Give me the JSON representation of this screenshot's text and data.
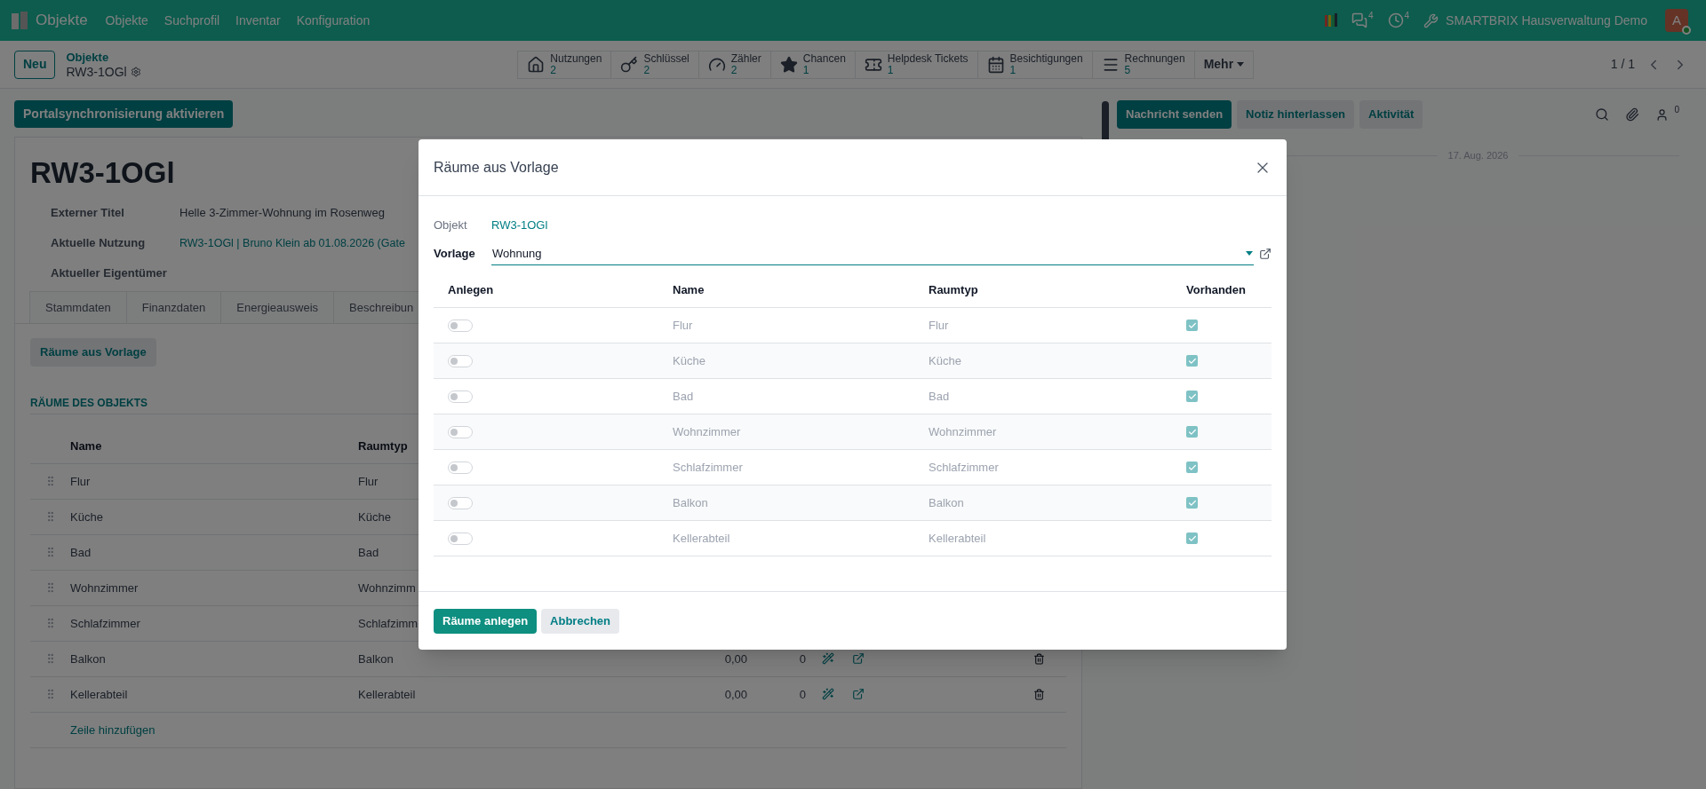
{
  "navbar": {
    "app": "Objekte",
    "menu": [
      "Objekte",
      "Suchprofil",
      "Inventar",
      "Konfiguration"
    ],
    "chat_count": "4",
    "activity_count": "4",
    "company": "SMARTBRIX Hausverwaltung Demo",
    "avatar": "A"
  },
  "control_panel": {
    "new_button": "Neu",
    "breadcrumb": "Objekte",
    "record": "RW3-1OGl",
    "stat_buttons": [
      {
        "kind": "home",
        "label": "Nutzungen",
        "value": "2"
      },
      {
        "kind": "key",
        "label": "Schlüssel",
        "value": "2"
      },
      {
        "kind": "gauge",
        "label": "Zähler",
        "value": "2"
      },
      {
        "kind": "star",
        "label": "Chancen",
        "value": "1"
      },
      {
        "kind": "ticket",
        "label": "Helpdesk Tickets",
        "value": "1"
      },
      {
        "kind": "calendar",
        "label": "Besichtigungen",
        "value": "1"
      },
      {
        "kind": "list",
        "label": "Rechnungen",
        "value": "5"
      }
    ],
    "more": "Mehr",
    "pager": "1 / 1"
  },
  "form": {
    "action_button": "Portalsynchronisierung aktivieren",
    "title": "RW3-1OGl",
    "fields": [
      {
        "label": "Externer Titel",
        "value": "Helle 3-Zimmer-Wohnung im Rosenweg",
        "kind": "text"
      },
      {
        "label": "Aktuelle Nutzung",
        "value": "RW3-1OGl | Bruno Klein ab 01.08.2026 (Gate",
        "kind": "link"
      },
      {
        "label": "Aktueller Eigentümer"
      }
    ],
    "tabs": [
      {
        "label": "Stammdaten",
        "selected": false
      },
      {
        "label": "Finanzdaten",
        "selected": false
      },
      {
        "label": "Energieausweis",
        "selected": false
      },
      {
        "label": "Beschreibun",
        "selected": false
      }
    ],
    "template_button": "Räume aus Vorlage",
    "section_title": "RÄUME DES OBJEKTS",
    "columns": [
      "Name",
      "Raumtyp"
    ],
    "rows": [
      {
        "name": "Flur",
        "type": "Flur"
      },
      {
        "name": "Küche",
        "type": "Küche"
      },
      {
        "name": "Bad",
        "type": "Bad"
      },
      {
        "name": "Wohnzimmer",
        "type": "Wohnzimm"
      },
      {
        "name": "Schlafzimmer",
        "type": "Schlafzimm"
      },
      {
        "name": "Balkon",
        "type": "Balkon",
        "column_3": "0,00",
        "column_4": "0"
      },
      {
        "name": "Kellerabteil",
        "type": "Kellerabteil",
        "column_3": "0,00",
        "column_4": "0"
      }
    ],
    "add_line": "Zeile hinzufügen"
  },
  "chatter": {
    "buttons": [
      {
        "label": "Nachricht senden",
        "selected": true
      },
      {
        "label": "Notiz hinterlassen",
        "selected": false
      },
      {
        "label": "Aktivität",
        "selected": false
      }
    ],
    "follower_count": "0",
    "date": "17. Aug. 2026"
  },
  "dialog": {
    "title": "Räume aus Vorlage",
    "object_label": "Objekt",
    "object_value": "RW3-1OGl",
    "template_label": "Vorlage",
    "template_value": "Wohnung",
    "columns": [
      "Anlegen",
      "Name",
      "Raumtyp",
      "Vorhanden"
    ],
    "rows": [
      {
        "create": false,
        "name": "Flur",
        "type": "Flur",
        "existing": true
      },
      {
        "create": false,
        "name": "Küche",
        "type": "Küche",
        "existing": true
      },
      {
        "create": false,
        "name": "Bad",
        "type": "Bad",
        "existing": true
      },
      {
        "create": false,
        "name": "Wohnzimmer",
        "type": "Wohnzimmer",
        "existing": true
      },
      {
        "create": false,
        "name": "Schlafzimmer",
        "type": "Schlafzimmer",
        "existing": true
      },
      {
        "create": false,
        "name": "Balkon",
        "type": "Balkon",
        "existing": true
      },
      {
        "create": false,
        "name": "Kellerabteil",
        "type": "Kellerabteil",
        "existing": true
      }
    ],
    "buttons": [
      {
        "label": "Räume anlegen",
        "kind": "primary"
      },
      {
        "label": "Abbrechen",
        "kind": "secondary"
      }
    ]
  }
}
